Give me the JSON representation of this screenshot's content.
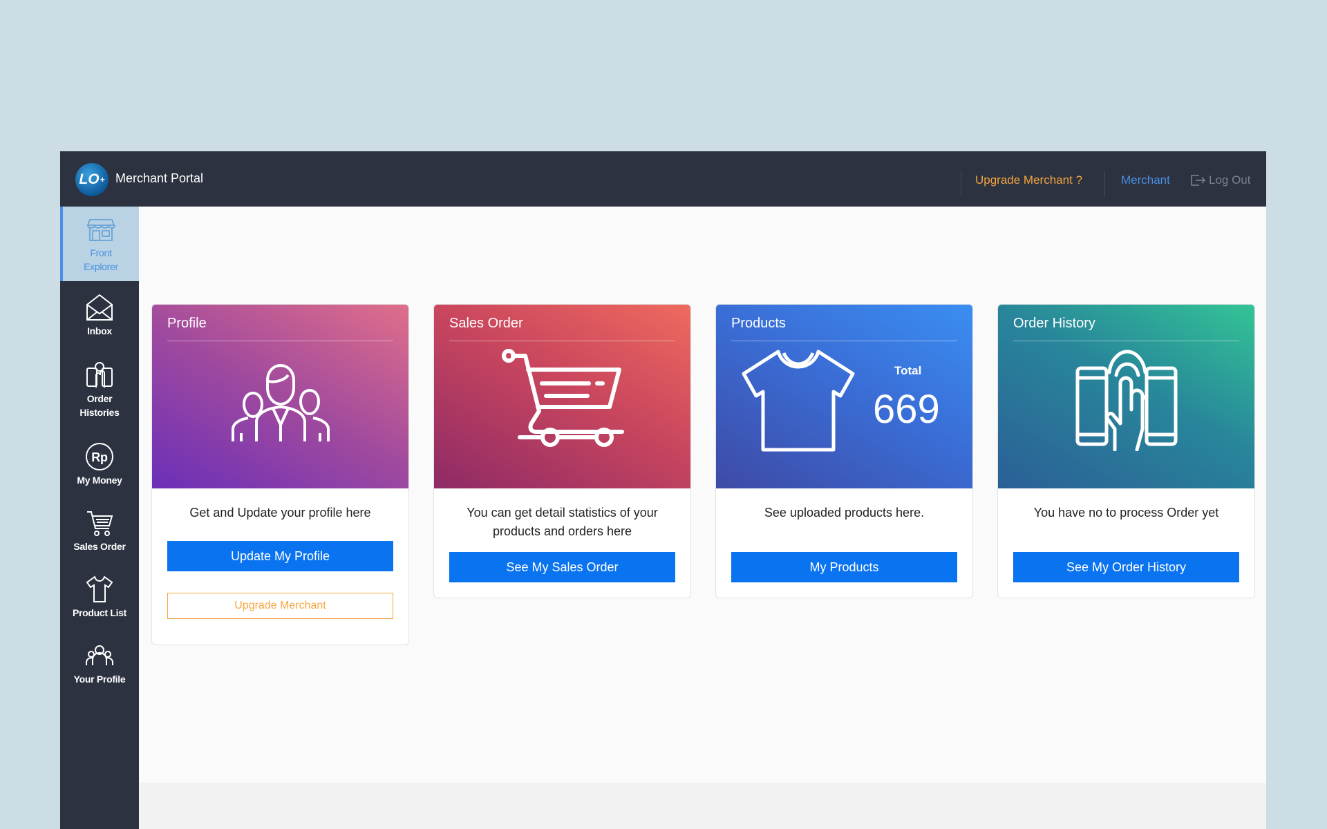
{
  "header": {
    "logo_text": "LO",
    "app_title": "Merchant Portal",
    "upgrade_link": "Upgrade Merchant ?",
    "user_link": "Merchant",
    "logout_label": "Log Out"
  },
  "sidebar": {
    "items": [
      {
        "label": "Front Explorer",
        "icon": "storefront-icon",
        "active": true
      },
      {
        "label": "Inbox",
        "icon": "envelope-icon"
      },
      {
        "label": "Order Histories",
        "icon": "order-histories-icon"
      },
      {
        "label": "My Money",
        "icon": "rupiah-coin-icon"
      },
      {
        "label": "Sales Order",
        "icon": "shopping-cart-icon"
      },
      {
        "label": "Product List",
        "icon": "tshirt-icon"
      },
      {
        "label": "Your Profile",
        "icon": "team-icon"
      }
    ]
  },
  "cards": {
    "profile": {
      "title": "Profile",
      "icon": "team-icon",
      "description": "Get and Update your profile here",
      "primary_button": "Update My Profile",
      "secondary_button": "Upgrade Merchant"
    },
    "sales": {
      "title": "Sales Order",
      "icon": "shopping-cart-icon",
      "description": "You can get detail statistics of your products and orders here",
      "primary_button": "See My Sales Order"
    },
    "products": {
      "title": "Products",
      "icon": "tshirt-icon",
      "total_label": "Total",
      "total_value": "669",
      "description": "See uploaded products here.",
      "primary_button": "My Products"
    },
    "history": {
      "title": "Order History",
      "icon": "tablet-touch-icon",
      "description": "You have no to process Order yet",
      "primary_button": "See My Order History"
    }
  },
  "colors": {
    "topbar": "#2c3240",
    "accent_blue": "#0a73f0",
    "accent_orange": "#f5a540",
    "link_blue": "#4a90e2"
  }
}
